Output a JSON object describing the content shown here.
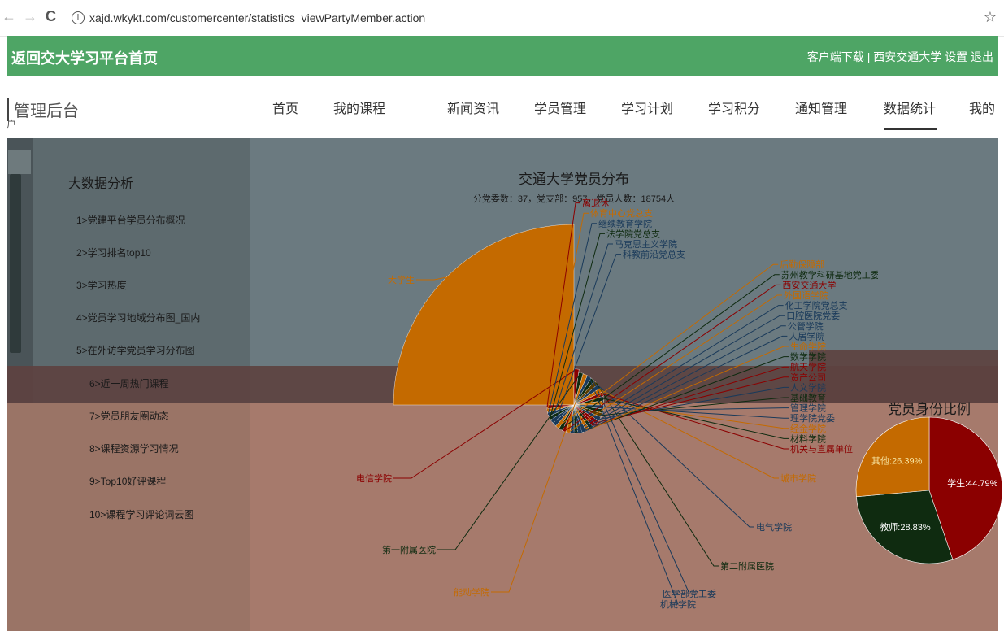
{
  "browser": {
    "back": "←",
    "forward": "→",
    "reload": "C",
    "info": "i",
    "url": "xajd.wkykt.com/customercenter/statistics_viewPartyMember.action",
    "star": "☆"
  },
  "header": {
    "home_link": "返回交大学习平台首页",
    "download": "客户端下载",
    "separator": "|",
    "university": "西安交通大学",
    "settings": "设置",
    "logout": "退出"
  },
  "nav": {
    "admin_title": "管理后台",
    "admin_sub": "户",
    "items": [
      "首页",
      "我的课程",
      "新闻资讯",
      "学员管理",
      "学习计划",
      "学习积分",
      "通知管理",
      "数据统计",
      "我的"
    ]
  },
  "sidebar": {
    "title": "大数据分析",
    "items": [
      "1>党建平台学员分布概况",
      "2>学习排名top10",
      "3>学习热度",
      "4>党员学习地域分布图_国内",
      "5>在外访学党员学习分布图",
      "6>近一周热门课程",
      "7>党员朋友圈动态",
      "8>课程资源学习情况",
      "9>Top10好评课程",
      "10>课程学习评论词云图"
    ]
  },
  "colors": {
    "green": "#4ea565",
    "dark_red": "#8b0000",
    "orange": "#c46a00",
    "dark_green": "#0f2b10"
  },
  "chart_data": [
    {
      "type": "pie",
      "title": "交通大学党员分布",
      "subtitle": "分党委数：37，党支部：957，党员人数：18754人",
      "slices": [
        {
          "label": "大学生",
          "value": 4800
        },
        {
          "label": "电信学院",
          "value": 420
        },
        {
          "label": "第一附属医院",
          "value": 220
        },
        {
          "label": "能动学院",
          "value": 200
        },
        {
          "label": "机械学院",
          "value": 180
        },
        {
          "label": "医学部党工委",
          "value": 170
        },
        {
          "label": "第二附属医院",
          "value": 160
        },
        {
          "label": "电气学院",
          "value": 150
        },
        {
          "label": "城市学院",
          "value": 140
        },
        {
          "label": "机关与直属单位",
          "value": 130
        },
        {
          "label": "材料学院",
          "value": 110
        },
        {
          "label": "经金学院",
          "value": 100
        },
        {
          "label": "理学院党委",
          "value": 95
        },
        {
          "label": "管理学院",
          "value": 90
        },
        {
          "label": "基础教育",
          "value": 85
        },
        {
          "label": "人文学院",
          "value": 80
        },
        {
          "label": "资产公司",
          "value": 75
        },
        {
          "label": "航天学院",
          "value": 70
        },
        {
          "label": "数学学院",
          "value": 65
        },
        {
          "label": "生命学院",
          "value": 60
        },
        {
          "label": "人居学院",
          "value": 55
        },
        {
          "label": "公管学院",
          "value": 55
        },
        {
          "label": "口腔医院党委",
          "value": 50
        },
        {
          "label": "化工学院党总支",
          "value": 50
        },
        {
          "label": "外国语学院",
          "value": 45
        },
        {
          "label": "西安交通大学",
          "value": 45
        },
        {
          "label": "苏州教学科研基地党工委",
          "value": 40
        },
        {
          "label": "后勤保障部",
          "value": 40
        },
        {
          "label": "科教前沿党总支",
          "value": 35
        },
        {
          "label": "马克思主义学院",
          "value": 35
        },
        {
          "label": "法学院党总支",
          "value": 30
        },
        {
          "label": "继续教育学院",
          "value": 30
        },
        {
          "label": "体育中心党总支",
          "value": 25
        },
        {
          "label": "离退休",
          "value": 20
        }
      ]
    },
    {
      "type": "pie",
      "title": "党员身份比例",
      "slices": [
        {
          "label": "学生",
          "value": 44.79,
          "text": "学生:44.79%"
        },
        {
          "label": "教师",
          "value": 28.83,
          "text": "教师:28.83%"
        },
        {
          "label": "其他",
          "value": 26.39,
          "text": "其他:26.39%"
        }
      ]
    }
  ]
}
